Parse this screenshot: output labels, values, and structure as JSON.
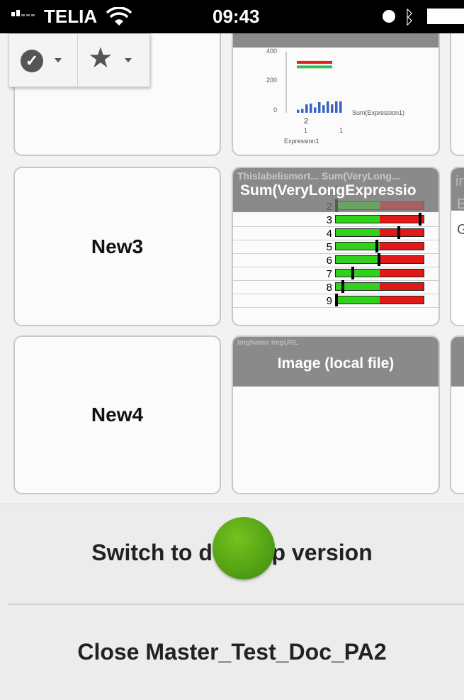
{
  "status_bar": {
    "carrier": "TELIA",
    "time": "09:43"
  },
  "toolbar": {
    "items": [
      {
        "icon": "check-circle-icon"
      },
      {
        "icon": "star-icon"
      }
    ]
  },
  "sheets": [
    {
      "row": 0,
      "col": 0,
      "label": ""
    },
    {
      "row": 0,
      "col": 1,
      "chart_data": {
        "type": "bar",
        "title": "",
        "xlabel": "Expression1",
        "legend": "Sum(Expression1)",
        "y_ticks": [
          "400",
          "200",
          "0"
        ],
        "x_ticks": [
          "2",
          "1",
          "1"
        ],
        "ylim": [
          0,
          400
        ],
        "values": [
          20,
          25,
          55,
          60,
          35,
          70,
          50,
          75,
          55,
          75,
          75
        ],
        "reference_lines": [
          {
            "color": "#e02020",
            "value": 340
          },
          {
            "color": "#2ec24b",
            "value": 310
          }
        ]
      }
    },
    {
      "row": 1,
      "col": 0,
      "label": "New3"
    },
    {
      "row": 1,
      "col": 1,
      "title": "Sum(VeryLongExpressio",
      "ghost_header": "Thislabelismort...  Sum(VeryLong...",
      "gauge_rows": [
        {
          "label": "2",
          "green": 0.5,
          "marker": 0.0
        },
        {
          "label": "3",
          "green": 0.5,
          "marker": 0.97
        },
        {
          "label": "4",
          "green": 0.5,
          "marker": 0.72
        },
        {
          "label": "5",
          "green": 0.5,
          "marker": 0.47
        },
        {
          "label": "6",
          "green": 0.5,
          "marker": 0.49
        },
        {
          "label": "7",
          "green": 0.5,
          "marker": 0.19
        },
        {
          "label": "8",
          "green": 0.5,
          "marker": 0.07
        },
        {
          "label": "9",
          "green": 0.5,
          "marker": 0.0
        }
      ]
    },
    {
      "row": 2,
      "col": 0,
      "label": "New4"
    },
    {
      "row": 2,
      "col": 1,
      "title": "Image (local file)",
      "ghost_header": "ImgName    ImgURL"
    }
  ],
  "right_column_partial": {
    "row1_glyphs": [
      "in",
      "E",
      "G"
    ]
  },
  "bottom_actions": {
    "switch_label": "Switch to desktop version",
    "close_label": "Close Master_Test_Doc_PA2"
  },
  "colors": {
    "accent_green": "#5aa614",
    "header_grey": "#8a8a8a"
  }
}
